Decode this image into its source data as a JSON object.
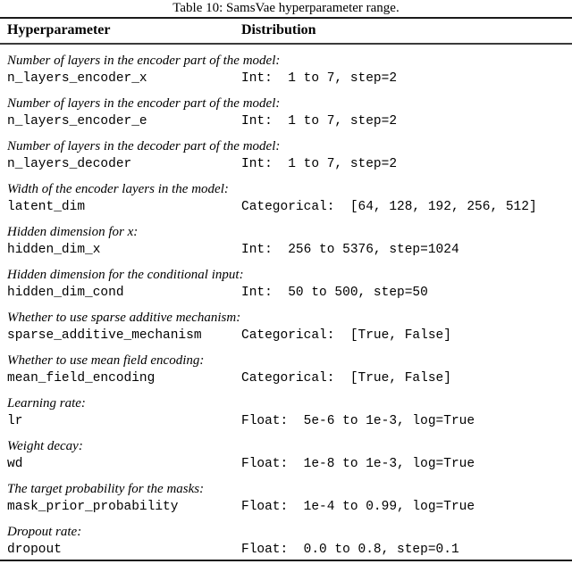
{
  "caption": "Table 10: SamsVae hyperparameter range.",
  "table": {
    "columns": [
      "Hyperparameter",
      "Distribution"
    ],
    "rows": [
      {
        "description": "Number of layers in the encoder part of the model:",
        "name": "n_layers_encoder_x",
        "distribution": "Int:  1 to 7, step=2"
      },
      {
        "description": "Number of layers in the encoder part of the model:",
        "name": "n_layers_encoder_e",
        "distribution": "Int:  1 to 7, step=2"
      },
      {
        "description": "Number of layers in the decoder part of the model:",
        "name": "n_layers_decoder",
        "distribution": "Int:  1 to 7, step=2"
      },
      {
        "description": "Width of the encoder layers in the model:",
        "name": "latent_dim",
        "distribution": "Categorical:  [64, 128, 192, 256, 512]"
      },
      {
        "description": "Hidden dimension for x:",
        "name": "hidden_dim_x",
        "distribution": "Int:  256 to 5376, step=1024"
      },
      {
        "description": "Hidden dimension for the conditional input:",
        "name": "hidden_dim_cond",
        "distribution": "Int:  50 to 500, step=50"
      },
      {
        "description": "Whether to use sparse additive mechanism:",
        "name": "sparse_additive_mechanism",
        "distribution": "Categorical:  [True, False]"
      },
      {
        "description": "Whether to use mean field encoding:",
        "name": "mean_field_encoding",
        "distribution": "Categorical:  [True, False]"
      },
      {
        "description": "Learning rate:",
        "name": "lr",
        "distribution": "Float:  5e-6 to 1e-3, log=True"
      },
      {
        "description": "Weight decay:",
        "name": "wd",
        "distribution": "Float:  1e-8 to 1e-3, log=True"
      },
      {
        "description": "The target probability for the masks:",
        "name": "mask_prior_probability",
        "distribution": "Float:  1e-4 to 0.99, log=True"
      },
      {
        "description": "Dropout rate:",
        "name": "dropout",
        "distribution": "Float:  0.0 to 0.8, step=0.1"
      }
    ]
  }
}
